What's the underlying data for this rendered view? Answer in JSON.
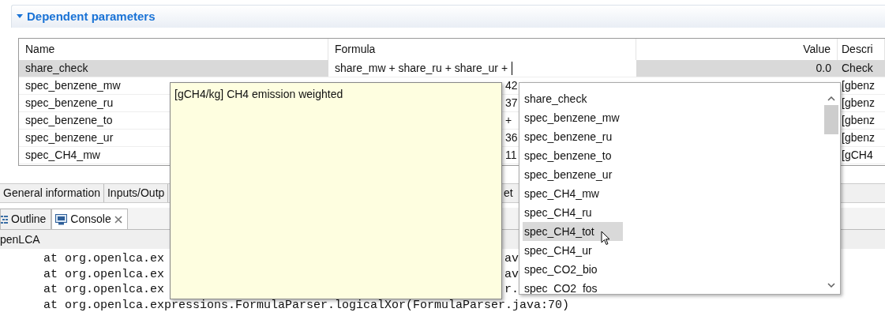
{
  "section": {
    "title": "Dependent parameters",
    "expanded": true
  },
  "table": {
    "columns": [
      "Name",
      "Formula",
      "Value",
      "Descri"
    ],
    "rows": [
      {
        "name": "share_check",
        "formula": "share_mw + share_ru + share_ur +",
        "value": "0.0",
        "description": "Check",
        "selected": true,
        "editing": true
      },
      {
        "name": "spec_benzene_mw",
        "formula": "42",
        "description": "[gbenz",
        "selected": false,
        "editing": false
      },
      {
        "name": "spec_benzene_ru",
        "formula": "37",
        "description": "[gbenz",
        "selected": false,
        "editing": false
      },
      {
        "name": "spec_benzene_to",
        "formula": "+",
        "description": "[gbenz",
        "selected": false,
        "editing": false
      },
      {
        "name": "spec_benzene_ur",
        "formula": "36",
        "description": "[gbenz",
        "selected": false,
        "editing": false
      },
      {
        "name": "spec_CH4_mw",
        "formula": "11",
        "description": "[gCH4",
        "selected": false,
        "editing": false
      }
    ]
  },
  "editor_tabs": [
    {
      "label": "General information"
    },
    {
      "label": "Inputs/Outp"
    },
    {
      "label": "et"
    }
  ],
  "views": [
    {
      "label": "Outline",
      "kind": "outline",
      "selected": false,
      "closable": false
    },
    {
      "label": "Console",
      "kind": "console",
      "selected": true,
      "closable": true
    }
  ],
  "console": {
    "title": "penLCA",
    "lines": [
      {
        "text": "at org.openlca.ex",
        "tail": "av"
      },
      {
        "text": "at org.openlca.ex",
        "tail": "av"
      },
      {
        "text": "at org.openlca.ex",
        "tail": "r."
      },
      {
        "text": "at org.openlca.expressions.FormulaParser.logicalXor(FormulaParser.java:70)"
      }
    ]
  },
  "tooltip": {
    "text": "[gCH4/kg] CH4 emission weighted"
  },
  "popup": {
    "items": [
      {
        "label": "share_check",
        "selected": false
      },
      {
        "label": "spec_benzene_mw",
        "selected": false
      },
      {
        "label": "spec_benzene_ru",
        "selected": false
      },
      {
        "label": "spec_benzene_to",
        "selected": false
      },
      {
        "label": "spec_benzene_ur",
        "selected": false
      },
      {
        "label": "spec_CH4_mw",
        "selected": false
      },
      {
        "label": "spec_CH4_ru",
        "selected": false
      },
      {
        "label": "spec_CH4_tot",
        "selected": true
      },
      {
        "label": "spec_CH4_ur",
        "selected": false
      },
      {
        "label": "spec_CO2_bio",
        "selected": false
      },
      {
        "label": "spec_CO2_fos",
        "selected": false
      }
    ]
  }
}
